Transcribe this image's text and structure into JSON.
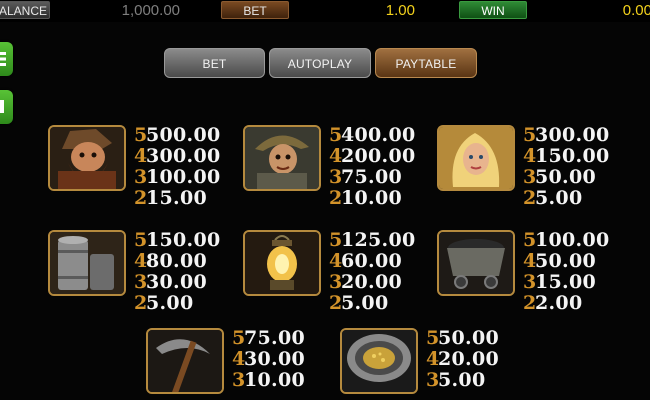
{
  "topbar": {
    "balance_label": "ALANCE",
    "balance_value": "1,000.00",
    "bet_label": "BET",
    "bet_value": "1.00",
    "win_label": "WIN",
    "win_value": "0.00"
  },
  "sidebar": {
    "items": [
      {
        "icon": "menu-icon"
      },
      {
        "icon": "plus-icon"
      }
    ]
  },
  "tabs": [
    {
      "label": "BET",
      "active": false
    },
    {
      "label": "AUTOPLAY",
      "active": false
    },
    {
      "label": "PAYTABLE",
      "active": true
    }
  ],
  "colors": {
    "count": "#d3932a",
    "amount": "#f4f4f4",
    "frame": "#b58a3e",
    "accent_gold": "#f3d21c"
  },
  "paytable": [
    {
      "symbol": "bearded-miner",
      "rows": [
        {
          "count": "5",
          "amount": "500.00"
        },
        {
          "count": "4",
          "amount": "300.00"
        },
        {
          "count": "3",
          "amount": "100.00"
        },
        {
          "count": "2",
          "amount": "15.00"
        }
      ]
    },
    {
      "symbol": "miner-with-hat",
      "rows": [
        {
          "count": "5",
          "amount": "400.00"
        },
        {
          "count": "4",
          "amount": "200.00"
        },
        {
          "count": "3",
          "amount": "75.00"
        },
        {
          "count": "2",
          "amount": "10.00"
        }
      ]
    },
    {
      "symbol": "blonde-woman",
      "rows": [
        {
          "count": "5",
          "amount": "300.00"
        },
        {
          "count": "4",
          "amount": "150.00"
        },
        {
          "count": "3",
          "amount": "50.00"
        },
        {
          "count": "2",
          "amount": "5.00"
        }
      ]
    },
    {
      "symbol": "metal-barrel",
      "rows": [
        {
          "count": "5",
          "amount": "150.00"
        },
        {
          "count": "4",
          "amount": "80.00"
        },
        {
          "count": "3",
          "amount": "30.00"
        },
        {
          "count": "2",
          "amount": "5.00"
        }
      ]
    },
    {
      "symbol": "oil-lantern",
      "rows": [
        {
          "count": "5",
          "amount": "125.00"
        },
        {
          "count": "4",
          "amount": "60.00"
        },
        {
          "count": "3",
          "amount": "20.00"
        },
        {
          "count": "2",
          "amount": "5.00"
        }
      ]
    },
    {
      "symbol": "coal-mine-cart",
      "rows": [
        {
          "count": "5",
          "amount": "100.00"
        },
        {
          "count": "4",
          "amount": "50.00"
        },
        {
          "count": "3",
          "amount": "15.00"
        },
        {
          "count": "2",
          "amount": "2.00"
        }
      ]
    },
    {
      "symbol": "pickaxe",
      "rows": [
        {
          "count": "5",
          "amount": "75.00"
        },
        {
          "count": "4",
          "amount": "30.00"
        },
        {
          "count": "3",
          "amount": "10.00"
        }
      ]
    },
    {
      "symbol": "gold-pan",
      "rows": [
        {
          "count": "5",
          "amount": "50.00"
        },
        {
          "count": "4",
          "amount": "20.00"
        },
        {
          "count": "3",
          "amount": "5.00"
        }
      ]
    }
  ]
}
